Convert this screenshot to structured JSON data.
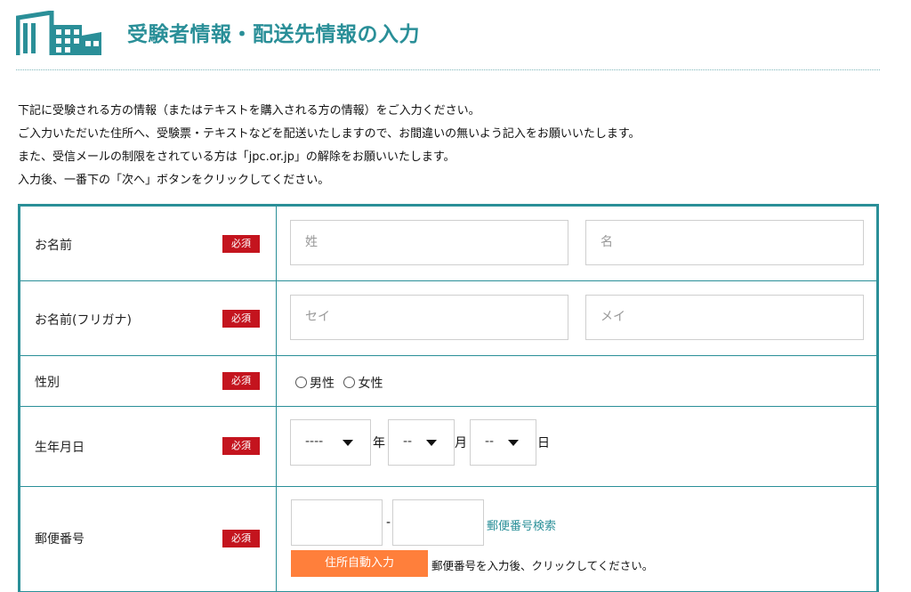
{
  "header": {
    "title": "受験者情報・配送先情報の入力",
    "accent_color": "#2a8f98",
    "logo_icon": "building-icon"
  },
  "intro": {
    "lines": [
      "下記に受験される方の情報（またはテキストを購入される方の情報）をご入力ください。",
      "ご入力いただいた住所へ、受験票・テキストなどを配送いたしますので、お間違いの無いよう記入をお願いいたします。",
      "また、受信メールの制限をされている方は「jpc.or.jp」の解除をお願いいたします。",
      "入力後、一番下の「次へ」ボタンをクリックしてください。"
    ]
  },
  "required_label": "必須",
  "required_color": "#c4141e",
  "form": {
    "name": {
      "label": "お名前",
      "last_placeholder": "姓",
      "first_placeholder": "名"
    },
    "kana": {
      "label": "お名前(フリガナ)",
      "last_placeholder": "セイ",
      "first_placeholder": "メイ"
    },
    "gender": {
      "label": "性別",
      "options": [
        "男性",
        "女性"
      ]
    },
    "birth": {
      "label": "生年月日",
      "year_value": "----",
      "year_unit": "年",
      "month_value": "--",
      "month_unit": "月",
      "day_value": "--",
      "day_unit": "日"
    },
    "zip": {
      "label": "郵便番号",
      "dash": "-",
      "search_link": "郵便番号検索",
      "auto_button": "住所自動入力",
      "auto_button_color": "#ff7f3b",
      "note": "郵便番号を入力後、クリックしてください。"
    }
  }
}
